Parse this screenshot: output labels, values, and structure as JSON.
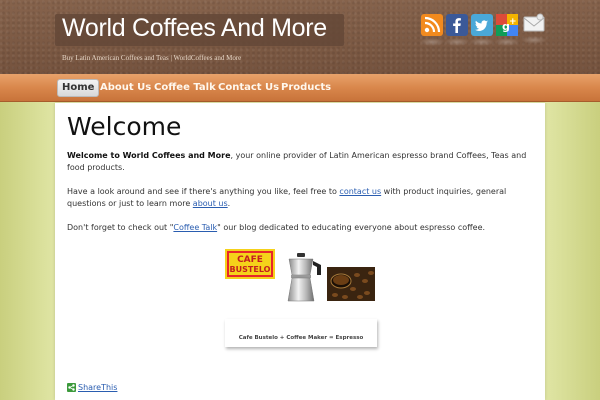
{
  "header": {
    "site_title": "World Coffees And More",
    "tagline": "Buy Latin American Coffees and Teas | WorldCoffees and More",
    "social_icons": [
      "rss-icon",
      "facebook-icon",
      "twitter-icon",
      "google-plus-icon",
      "email-icon"
    ]
  },
  "nav": {
    "items": [
      {
        "label": "Home",
        "active": true
      },
      {
        "label": "About Us",
        "active": false
      },
      {
        "label": "Coffee Talk",
        "active": false
      },
      {
        "label": "Contact Us",
        "active": false
      },
      {
        "label": "Products",
        "active": false
      }
    ]
  },
  "main": {
    "title": "Welcome",
    "intro_bold": "Welcome to World Coffees and More",
    "intro_rest": ", your online provider of Latin American espresso brand Coffees, Teas and food products.",
    "p2_a": "Have a look around and see if there's anything you like, feel free to ",
    "p2_link1": "contact us",
    "p2_b": " with product inquiries, general questions or just to learn more ",
    "p2_link2": "about us",
    "p2_c": ".",
    "p3_a": "Don't forget to check out \"",
    "p3_link": "Coffee Talk",
    "p3_b": "\" our blog dedicated to educating everyone about espresso coffee.",
    "images": {
      "bustelo_text_1": "CAFE",
      "bustelo_text_2": "BUSTELO"
    },
    "caption": "Cafe Bustelo + Coffee Maker = Espresso",
    "share_label": "ShareThis"
  },
  "colors": {
    "header_brown": "#7a5842",
    "nav_orange": "#d9874c",
    "link_blue": "#2a5db0",
    "side_green": "#c9cf7e"
  }
}
